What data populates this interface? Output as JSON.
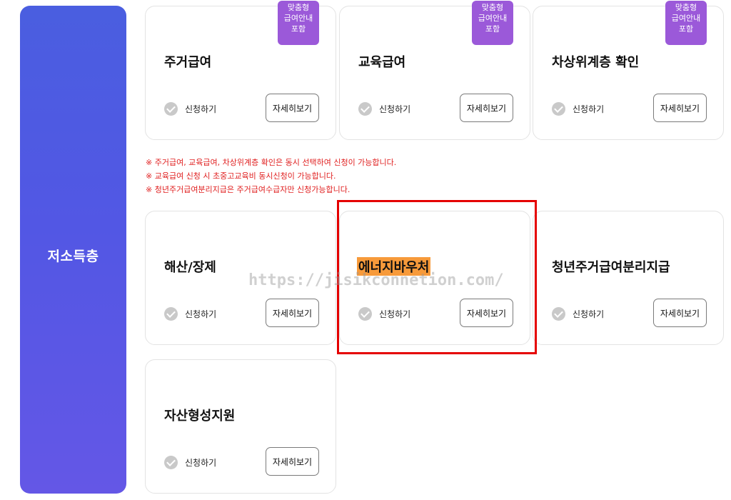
{
  "sidebar": {
    "title": "저소득층"
  },
  "cards": [
    {
      "title": "주거급여",
      "apply_label": "신청하기",
      "detail_label": "자세히보기",
      "badge": [
        "맞춤형",
        "급여안내",
        "포함"
      ]
    },
    {
      "title": "교육급여",
      "apply_label": "신청하기",
      "detail_label": "자세히보기",
      "badge": [
        "맞춤형",
        "급여안내",
        "포함"
      ]
    },
    {
      "title": "차상위계층 확인",
      "apply_label": "신청하기",
      "detail_label": "자세히보기",
      "badge": [
        "맞춤형",
        "급여안내",
        "포함"
      ]
    },
    {
      "title": "해산/장제",
      "apply_label": "신청하기",
      "detail_label": "자세히보기"
    },
    {
      "title": "에너지바우처",
      "apply_label": "신청하기",
      "detail_label": "자세히보기"
    },
    {
      "title": "청년주거급여분리지급",
      "apply_label": "신청하기",
      "detail_label": "자세히보기"
    },
    {
      "title": "자산형성지원",
      "apply_label": "신청하기",
      "detail_label": "자세히보기"
    }
  ],
  "notes": [
    "※ 주거급여, 교육급여, 차상위계층 확인은 동시 선택하여 신청이 가능합니다.",
    "※ 교육급여 신청 시 초중고교육비 동시신청이 가능합니다.",
    "※ 청년주거급여분리지급은 주거급여수급자만 신청가능합니다."
  ],
  "watermark": "https://jisikconnetion.com/",
  "colors": {
    "sidebar_gradient_top": "#4a5ee0",
    "sidebar_gradient_bottom": "#6457e6",
    "badge": "#9b59d9",
    "note_red": "#e02020",
    "highlight_box": "#e50000",
    "title_highlight": "#f79a3a"
  }
}
